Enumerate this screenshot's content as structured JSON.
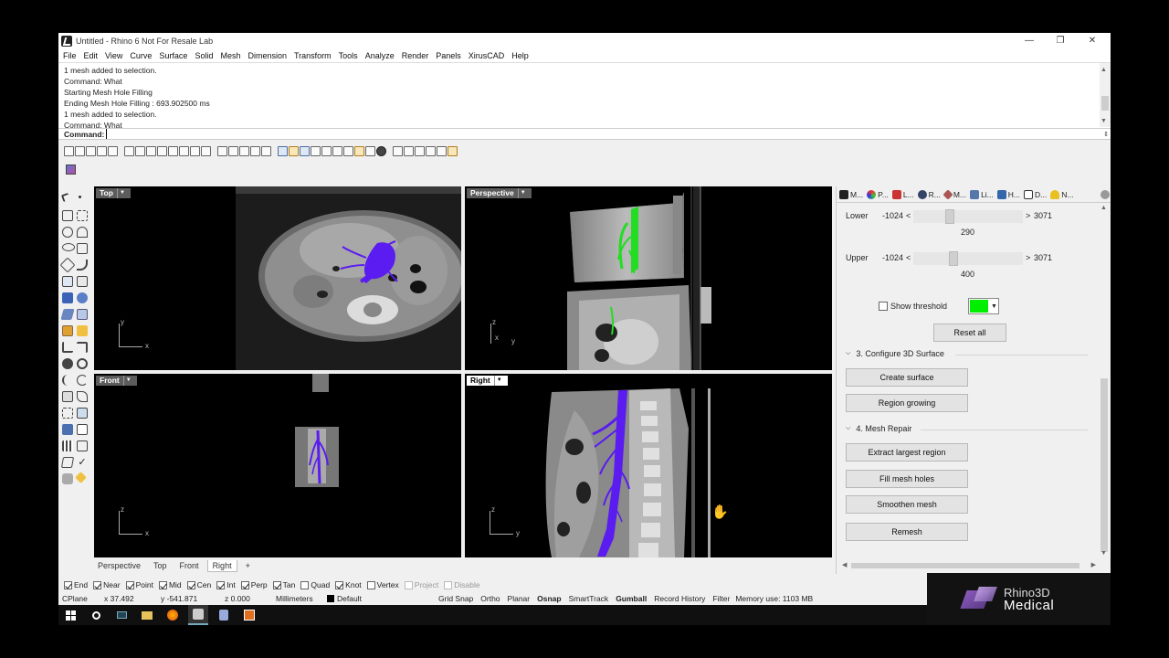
{
  "window": {
    "title": "Untitled - Rhino 6 Not For Resale Lab",
    "controls": [
      "—",
      "❐",
      "✕"
    ]
  },
  "menu": [
    "File",
    "Edit",
    "View",
    "Curve",
    "Surface",
    "Solid",
    "Mesh",
    "Dimension",
    "Transform",
    "Tools",
    "Analyze",
    "Render",
    "Panels",
    "XirusCAD",
    "Help"
  ],
  "command_history": [
    "1 mesh added to selection.",
    "Command: What",
    "Starting Mesh Hole Filling",
    "Ending Mesh Hole Filling : 693.902500 ms",
    "1 mesh added to selection.",
    "Command: What"
  ],
  "command_prompt": "Command:",
  "viewports": {
    "top": {
      "label": "Top",
      "axis_x": "x",
      "axis_y": "y"
    },
    "perspective": {
      "label": "Perspective",
      "axis_x": "y",
      "axis_y": "z",
      "axis_x2": "x"
    },
    "front": {
      "label": "Front",
      "axis_x": "x",
      "axis_y": "z"
    },
    "right": {
      "label": "Right",
      "axis_x": "y",
      "axis_y": "z"
    }
  },
  "viewport_tabs": [
    "Perspective",
    "Top",
    "Front",
    "Right",
    "+"
  ],
  "panel": {
    "tabs": [
      "M...",
      "P...",
      "L...",
      "R...",
      "M...",
      "Li...",
      "H...",
      "D...",
      "N..."
    ],
    "lower": {
      "label": "Lower",
      "min": "-1024",
      "max": "3071",
      "value": "290",
      "fraction": 0.32
    },
    "upper": {
      "label": "Upper",
      "min": "-1024",
      "max": "3071",
      "value": "400",
      "fraction": 0.35
    },
    "show_threshold": "Show threshold",
    "threshold_color": "#00ee00",
    "reset_all": "Reset all",
    "section3": "3. Configure 3D Surface",
    "create_surface": "Create surface",
    "region_growing": "Region growing",
    "section4": "4. Mesh Repair",
    "extract_largest": "Extract largest region",
    "fill_holes": "Fill mesh holes",
    "smoothen": "Smoothen mesh",
    "remesh": "Remesh"
  },
  "osnap": [
    {
      "label": "End",
      "checked": true
    },
    {
      "label": "Near",
      "checked": true
    },
    {
      "label": "Point",
      "checked": true
    },
    {
      "label": "Mid",
      "checked": true
    },
    {
      "label": "Cen",
      "checked": true
    },
    {
      "label": "Int",
      "checked": true
    },
    {
      "label": "Perp",
      "checked": true
    },
    {
      "label": "Tan",
      "checked": true
    },
    {
      "label": "Quad",
      "checked": false
    },
    {
      "label": "Knot",
      "checked": true
    },
    {
      "label": "Vertex",
      "checked": false
    },
    {
      "label": "Project",
      "checked": false,
      "disabled": true
    },
    {
      "label": "Disable",
      "checked": false,
      "disabled": true
    }
  ],
  "status": {
    "cplane": "CPlane",
    "x": "x 37.492",
    "y": "y -541.871",
    "z": "z 0.000",
    "units": "Millimeters",
    "layer": "Default",
    "grid_snap": "Grid Snap",
    "ortho": "Ortho",
    "planar": "Planar",
    "osnap": "Osnap",
    "smarttrack": "SmartTrack",
    "gumball": "Gumball",
    "record_history": "Record History",
    "filter": "Filter",
    "memory": "Memory use: 1103 MB"
  },
  "branding": {
    "line1": "Rhino3D",
    "line2": "Medical"
  },
  "colors": {
    "vessel": "#5a1cf0",
    "vessel_green": "#22dd22",
    "accent": "#0078d7"
  }
}
